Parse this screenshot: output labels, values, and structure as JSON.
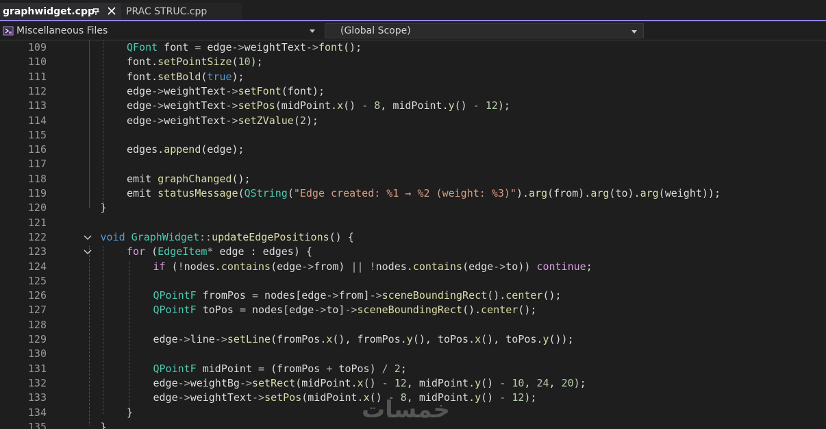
{
  "tabs": [
    {
      "label": "graphwidget.cpp",
      "active": true,
      "pinned": true
    },
    {
      "label": "PRAC STRUC.cpp",
      "active": false
    }
  ],
  "navbar": {
    "files_label": "Miscellaneous Files",
    "scope_label": "(Global Scope)"
  },
  "colors": {
    "accent": "#9184ee",
    "keyword": "#569cd6",
    "type": "#4ec9b0",
    "function": "#dcdcaa",
    "string": "#d69d85",
    "number": "#b5cea8",
    "control": "#d8a0df",
    "text": "#dcdcdc",
    "line_number": "#9b9b9b",
    "background": "#1e1e1e"
  },
  "editor": {
    "lines": [
      {
        "num": "109",
        "indent": 2,
        "tokens": [
          [
            "ty",
            "QFont"
          ],
          [
            "var",
            " font "
          ],
          [
            "op",
            "="
          ],
          [
            "var",
            " edge"
          ],
          [
            "op",
            "->"
          ],
          [
            "var",
            "weightText"
          ],
          [
            "op",
            "->"
          ],
          [
            "fn",
            "font"
          ],
          [
            "var",
            "();"
          ]
        ]
      },
      {
        "num": "110",
        "indent": 2,
        "tokens": [
          [
            "var",
            "font."
          ],
          [
            "fn",
            "setPointSize"
          ],
          [
            "var",
            "("
          ],
          [
            "num",
            "10"
          ],
          [
            "var",
            ");"
          ]
        ]
      },
      {
        "num": "111",
        "indent": 2,
        "tokens": [
          [
            "var",
            "font."
          ],
          [
            "fn",
            "setBold"
          ],
          [
            "var",
            "("
          ],
          [
            "kw",
            "true"
          ],
          [
            "var",
            ");"
          ]
        ]
      },
      {
        "num": "112",
        "indent": 2,
        "tokens": [
          [
            "var",
            "edge"
          ],
          [
            "op",
            "->"
          ],
          [
            "var",
            "weightText"
          ],
          [
            "op",
            "->"
          ],
          [
            "fn",
            "setFont"
          ],
          [
            "var",
            "(font);"
          ]
        ]
      },
      {
        "num": "113",
        "indent": 2,
        "tokens": [
          [
            "var",
            "edge"
          ],
          [
            "op",
            "->"
          ],
          [
            "var",
            "weightText"
          ],
          [
            "op",
            "->"
          ],
          [
            "fn",
            "setPos"
          ],
          [
            "var",
            "(midPoint."
          ],
          [
            "fn",
            "x"
          ],
          [
            "var",
            "() "
          ],
          [
            "op",
            "-"
          ],
          [
            "var",
            " "
          ],
          [
            "num",
            "8"
          ],
          [
            "var",
            ", midPoint."
          ],
          [
            "fn",
            "y"
          ],
          [
            "var",
            "() "
          ],
          [
            "op",
            "-"
          ],
          [
            "var",
            " "
          ],
          [
            "num",
            "12"
          ],
          [
            "var",
            ");"
          ]
        ]
      },
      {
        "num": "114",
        "indent": 2,
        "tokens": [
          [
            "var",
            "edge"
          ],
          [
            "op",
            "->"
          ],
          [
            "var",
            "weightText"
          ],
          [
            "op",
            "->"
          ],
          [
            "fn",
            "setZValue"
          ],
          [
            "var",
            "("
          ],
          [
            "num",
            "2"
          ],
          [
            "var",
            ");"
          ]
        ]
      },
      {
        "num": "115",
        "indent": 2,
        "tokens": []
      },
      {
        "num": "116",
        "indent": 2,
        "tokens": [
          [
            "var",
            "edges."
          ],
          [
            "fn",
            "append"
          ],
          [
            "var",
            "(edge);"
          ]
        ]
      },
      {
        "num": "117",
        "indent": 2,
        "tokens": []
      },
      {
        "num": "118",
        "indent": 2,
        "tokens": [
          [
            "var",
            "emit "
          ],
          [
            "fn",
            "graphChanged"
          ],
          [
            "var",
            "();"
          ]
        ]
      },
      {
        "num": "119",
        "indent": 2,
        "tokens": [
          [
            "var",
            "emit "
          ],
          [
            "fn",
            "statusMessage"
          ],
          [
            "var",
            "("
          ],
          [
            "ty",
            "QString"
          ],
          [
            "var",
            "("
          ],
          [
            "str",
            "\"Edge created: %1 → %2 (weight: %3)\""
          ],
          [
            "var",
            ")."
          ],
          [
            "fn",
            "arg"
          ],
          [
            "var",
            "(from)."
          ],
          [
            "fn",
            "arg"
          ],
          [
            "var",
            "(to)."
          ],
          [
            "fn",
            "arg"
          ],
          [
            "var",
            "(weight));"
          ]
        ]
      },
      {
        "num": "120",
        "indent": 1,
        "tokens": [
          [
            "var",
            "}"
          ]
        ]
      },
      {
        "num": "121",
        "indent": 0,
        "tokens": []
      },
      {
        "num": "122",
        "indent": 1,
        "fold": true,
        "tokens": [
          [
            "kw",
            "void"
          ],
          [
            "var",
            " "
          ],
          [
            "ty",
            "GraphWidget"
          ],
          [
            "op",
            "::"
          ],
          [
            "fn",
            "updateEdgePositions"
          ],
          [
            "var",
            "() {"
          ]
        ]
      },
      {
        "num": "123",
        "indent": 2,
        "fold": true,
        "tokens": [
          [
            "ctl",
            "for"
          ],
          [
            "var",
            " ("
          ],
          [
            "ty",
            "EdgeItem"
          ],
          [
            "op",
            "*"
          ],
          [
            "var",
            " edge : edges) {"
          ]
        ]
      },
      {
        "num": "124",
        "indent": 3,
        "tokens": [
          [
            "ctl",
            "if"
          ],
          [
            "var",
            " ("
          ],
          [
            "op",
            "!"
          ],
          [
            "var",
            "nodes."
          ],
          [
            "fn",
            "contains"
          ],
          [
            "var",
            "(edge"
          ],
          [
            "op",
            "->"
          ],
          [
            "var",
            "from) "
          ],
          [
            "op",
            "||"
          ],
          [
            "var",
            " "
          ],
          [
            "op",
            "!"
          ],
          [
            "var",
            "nodes."
          ],
          [
            "fn",
            "contains"
          ],
          [
            "var",
            "(edge"
          ],
          [
            "op",
            "->"
          ],
          [
            "var",
            "to)) "
          ],
          [
            "ctl",
            "continue"
          ],
          [
            "var",
            ";"
          ]
        ]
      },
      {
        "num": "125",
        "indent": 3,
        "tokens": []
      },
      {
        "num": "126",
        "indent": 3,
        "tokens": [
          [
            "ty",
            "QPointF"
          ],
          [
            "var",
            " fromPos "
          ],
          [
            "op",
            "="
          ],
          [
            "var",
            " nodes[edge"
          ],
          [
            "op",
            "->"
          ],
          [
            "var",
            "from]"
          ],
          [
            "op",
            "->"
          ],
          [
            "fn",
            "sceneBoundingRect"
          ],
          [
            "var",
            "()."
          ],
          [
            "fn",
            "center"
          ],
          [
            "var",
            "();"
          ]
        ]
      },
      {
        "num": "127",
        "indent": 3,
        "tokens": [
          [
            "ty",
            "QPointF"
          ],
          [
            "var",
            " toPos "
          ],
          [
            "op",
            "="
          ],
          [
            "var",
            " nodes[edge"
          ],
          [
            "op",
            "->"
          ],
          [
            "var",
            "to]"
          ],
          [
            "op",
            "->"
          ],
          [
            "fn",
            "sceneBoundingRect"
          ],
          [
            "var",
            "()."
          ],
          [
            "fn",
            "center"
          ],
          [
            "var",
            "();"
          ]
        ]
      },
      {
        "num": "128",
        "indent": 3,
        "tokens": []
      },
      {
        "num": "129",
        "indent": 3,
        "tokens": [
          [
            "var",
            "edge"
          ],
          [
            "op",
            "->"
          ],
          [
            "var",
            "line"
          ],
          [
            "op",
            "->"
          ],
          [
            "fn",
            "setLine"
          ],
          [
            "var",
            "(fromPos."
          ],
          [
            "fn",
            "x"
          ],
          [
            "var",
            "(), fromPos."
          ],
          [
            "fn",
            "y"
          ],
          [
            "var",
            "(), toPos."
          ],
          [
            "fn",
            "x"
          ],
          [
            "var",
            "(), toPos."
          ],
          [
            "fn",
            "y"
          ],
          [
            "var",
            "());"
          ]
        ]
      },
      {
        "num": "130",
        "indent": 3,
        "tokens": []
      },
      {
        "num": "131",
        "indent": 3,
        "tokens": [
          [
            "ty",
            "QPointF"
          ],
          [
            "var",
            " midPoint "
          ],
          [
            "op",
            "="
          ],
          [
            "var",
            " (fromPos "
          ],
          [
            "op",
            "+"
          ],
          [
            "var",
            " toPos) "
          ],
          [
            "op",
            "/"
          ],
          [
            "var",
            " "
          ],
          [
            "num",
            "2"
          ],
          [
            "var",
            ";"
          ]
        ]
      },
      {
        "num": "132",
        "indent": 3,
        "tokens": [
          [
            "var",
            "edge"
          ],
          [
            "op",
            "->"
          ],
          [
            "var",
            "weightBg"
          ],
          [
            "op",
            "->"
          ],
          [
            "fn",
            "setRect"
          ],
          [
            "var",
            "(midPoint."
          ],
          [
            "fn",
            "x"
          ],
          [
            "var",
            "() "
          ],
          [
            "op",
            "-"
          ],
          [
            "var",
            " "
          ],
          [
            "num",
            "12"
          ],
          [
            "var",
            ", midPoint."
          ],
          [
            "fn",
            "y"
          ],
          [
            "var",
            "() "
          ],
          [
            "op",
            "-"
          ],
          [
            "var",
            " "
          ],
          [
            "num",
            "10"
          ],
          [
            "var",
            ", "
          ],
          [
            "num",
            "24"
          ],
          [
            "var",
            ", "
          ],
          [
            "num",
            "20"
          ],
          [
            "var",
            ");"
          ]
        ]
      },
      {
        "num": "133",
        "indent": 3,
        "tokens": [
          [
            "var",
            "edge"
          ],
          [
            "op",
            "->"
          ],
          [
            "var",
            "weightText"
          ],
          [
            "op",
            "->"
          ],
          [
            "fn",
            "setPos"
          ],
          [
            "var",
            "(midPoint."
          ],
          [
            "fn",
            "x"
          ],
          [
            "var",
            "() "
          ],
          [
            "op",
            "-"
          ],
          [
            "var",
            " "
          ],
          [
            "num",
            "8"
          ],
          [
            "var",
            ", midPoint."
          ],
          [
            "fn",
            "y"
          ],
          [
            "var",
            "() "
          ],
          [
            "op",
            "-"
          ],
          [
            "var",
            " "
          ],
          [
            "num",
            "12"
          ],
          [
            "var",
            ");"
          ]
        ]
      },
      {
        "num": "134",
        "indent": 2,
        "tokens": [
          [
            "var",
            "}"
          ]
        ]
      },
      {
        "num": "135",
        "indent": 1,
        "tokens": [
          [
            "var",
            "}"
          ]
        ]
      }
    ]
  },
  "watermark": {
    "text": "خمسات"
  }
}
